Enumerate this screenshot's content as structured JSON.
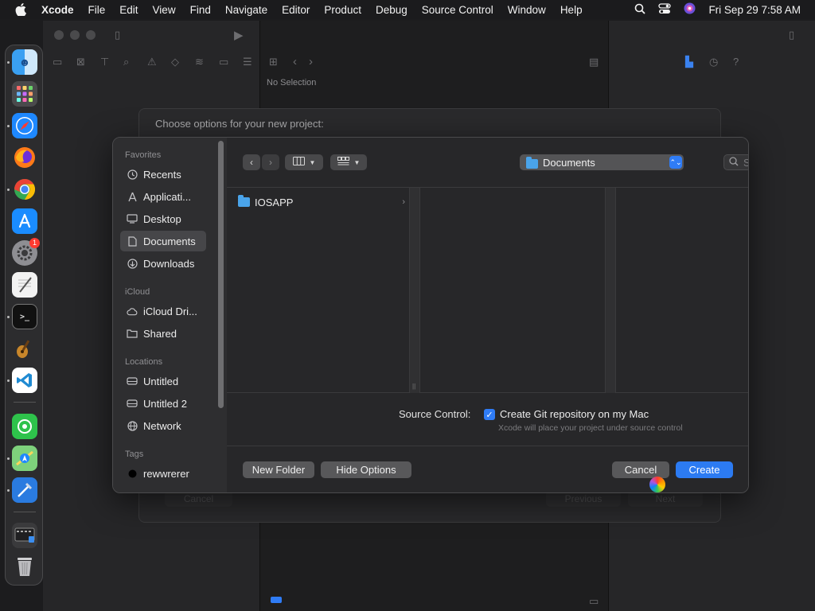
{
  "menubar": {
    "items": [
      "Xcode",
      "File",
      "Edit",
      "View",
      "Find",
      "Navigate",
      "Editor",
      "Product",
      "Debug",
      "Source Control",
      "Window",
      "Help"
    ],
    "datetime": "Fri Sep 29  7:58 AM"
  },
  "xcode": {
    "no_selection": "No Selection"
  },
  "back_sheet": {
    "title": "Choose options for your new project:",
    "cancel": "Cancel",
    "previous": "Previous",
    "next": "Next"
  },
  "dock": {
    "apps": [
      "Finder",
      "Launchpad",
      "Safari",
      "Firefox",
      "Chrome",
      "App Store",
      "System Settings",
      "TextEdit",
      "Terminal",
      "GarageBand",
      "VS Code",
      "Find My",
      "Maps",
      "Xcode",
      "Downloads",
      "Trash"
    ],
    "settings_badge": "1"
  },
  "dialog": {
    "sidebar": {
      "favorites_header": "Favorites",
      "favorites": [
        {
          "label": "Recents",
          "icon": "clock-icon"
        },
        {
          "label": "Applicati...",
          "icon": "applications-icon"
        },
        {
          "label": "Desktop",
          "icon": "desktop-icon"
        },
        {
          "label": "Documents",
          "icon": "document-icon"
        },
        {
          "label": "Downloads",
          "icon": "download-icon"
        }
      ],
      "icloud_header": "iCloud",
      "icloud": [
        {
          "label": "iCloud Dri...",
          "icon": "cloud-icon"
        },
        {
          "label": "Shared",
          "icon": "shared-folder-icon"
        }
      ],
      "locations_header": "Locations",
      "locations": [
        {
          "label": "Untitled",
          "icon": "drive-icon"
        },
        {
          "label": "Untitled 2",
          "icon": "drive-icon"
        },
        {
          "label": "Network",
          "icon": "network-icon"
        }
      ],
      "tags_header": "Tags",
      "tags": [
        {
          "label": "rewwrerer",
          "color": "#000000"
        }
      ]
    },
    "location": "Documents",
    "search_placeholder": "Search",
    "files": [
      {
        "name": "IOSAPP"
      }
    ],
    "source_control_label": "Source Control:",
    "git_checkbox_label": "Create Git repository on my Mac",
    "git_checked": true,
    "git_hint": "Xcode will place your project under source control",
    "new_folder": "New Folder",
    "hide_options": "Hide Options",
    "cancel": "Cancel",
    "create": "Create"
  },
  "colors": {
    "accent": "#2c7bf2",
    "folder": "#4aa4ea"
  }
}
